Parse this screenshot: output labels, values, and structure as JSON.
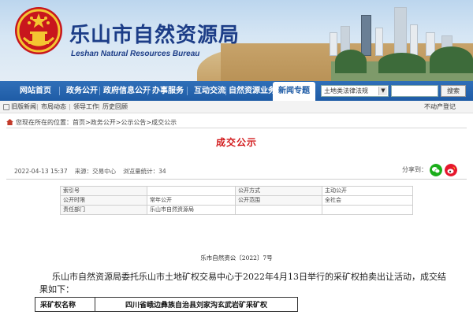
{
  "header": {
    "site_title": "乐山市自然资源局",
    "site_subtitle": "Leshan Natural Resources Bureau"
  },
  "nav": {
    "items": [
      "网站首页",
      "政务公开",
      "政府信息公开",
      "办事服务",
      "互动交流",
      "自然资源业务"
    ],
    "active_item": "新闻专题",
    "select_value": "土地类法律法规",
    "search_label": "搜索"
  },
  "subbar": {
    "links": [
      "旧版新闻",
      "市局动态",
      "领导工作",
      "历史回顾"
    ],
    "right_link": "不动产登记"
  },
  "breadcrumb": {
    "prefix": "您现在所在的位置：",
    "path": "首页>政务公开>公示公告>成交公示"
  },
  "article": {
    "title": "成交公示",
    "date": "2022-04-13 15:37",
    "source": "来源：交易中心",
    "views": "浏览量统计：34",
    "share_label": "分享到："
  },
  "info_table": {
    "rows": [
      [
        "索引号",
        "",
        "公开方式",
        "主动公开"
      ],
      [
        "公开时限",
        "常年公开",
        "公开范围",
        "全社会"
      ],
      [
        "责任部门",
        "乐山市自然资源局",
        "",
        ""
      ]
    ]
  },
  "document": {
    "doc_no": "乐市自然资公〔2022〕7号",
    "body": "乐山市自然资源局委托乐山市土地矿权交易中心于2022年4月13日举行的采矿权拍卖出让活动，成交结果如下：",
    "result_label": "采矿权名称",
    "result_value": "四川省峨边彝族自治县刘家沟玄武岩矿采矿权"
  },
  "colors": {
    "nav_blue": "#1f5ca6",
    "title_red": "#d2191b",
    "brand_blue": "#1c3d87",
    "wechat_green": "#1aad19",
    "weibo_red": "#e6162d"
  }
}
